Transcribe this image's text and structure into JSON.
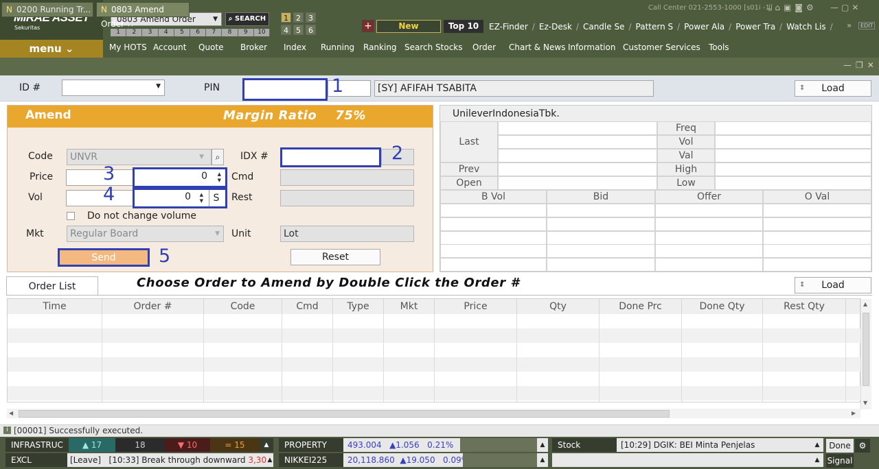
{
  "app": {
    "logo_main": "MIRAE ASSET",
    "logo_sub": "Sekuritas",
    "menu_label": "menu",
    "screen_select": "0803  Amend Order",
    "screen_numbers": [
      "1",
      "2",
      "3",
      "4",
      "5",
      "6",
      "7",
      "8",
      "9",
      "10"
    ],
    "search_label": "SEARCH",
    "window_buttons": [
      "1",
      "2",
      "3",
      "4",
      "5",
      "6"
    ],
    "call_center": "Call Center 021-2553-1000 [s01i -1]",
    "edit_label": "EDIT"
  },
  "toolbar": {
    "plus": "+",
    "new_label": "New",
    "top10_label": "Top 10",
    "quick_links": [
      "EZ-Finder",
      "Ez-Desk",
      "Candle Se",
      "Pattern S",
      "Power Ala",
      "Power Tra",
      "Watch Lis"
    ]
  },
  "nav": [
    "My HOTS",
    "Account",
    "Quote",
    "Broker",
    "Index",
    "Running",
    "Ranking",
    "Search Stocks",
    "Order",
    "Chart & News",
    "Information",
    "Customer Services",
    "Tools"
  ],
  "tabs": [
    {
      "prefix": "N",
      "label": "0200 Running Tr..."
    },
    {
      "prefix": "N",
      "label": "0803 Amend Order",
      "close": "×"
    }
  ],
  "idrow": {
    "id_label": "ID #",
    "id_value": "",
    "pin_label": "PIN",
    "pin_value": "",
    "account_name": "[SY] AFIFAH TSABITA",
    "load_label": "Load"
  },
  "amend": {
    "title": "Amend",
    "margin_label": "Margin Ratio",
    "margin_value": "75%",
    "code_label": "Code",
    "code_value": "UNVR",
    "idx_label": "IDX #",
    "idx_value": "",
    "price_label": "Price",
    "price_value": "0",
    "cmd_label": "Cmd",
    "vol_label": "Vol",
    "vol_value": "0",
    "s_label": "S",
    "rest_label": "Rest",
    "checkbox_label": "Do not change volume",
    "mkt_label": "Mkt",
    "mkt_value": "Regular Board",
    "unit_label": "Unit",
    "unit_value": "Lot",
    "send_label": "Send",
    "reset_label": "Reset"
  },
  "annotations": [
    "1",
    "2",
    "3",
    "4",
    "5"
  ],
  "quote": {
    "company": "UnileverIndonesiaTbk.",
    "last_label": "Last",
    "prev_label": "Prev",
    "open_label": "Open",
    "freq_label": "Freq",
    "vol_label": "Vol",
    "val_label": "Val",
    "high_label": "High",
    "low_label": "Low",
    "book_headers": [
      "B Vol",
      "Bid",
      "Offer",
      "O Val"
    ]
  },
  "orders": {
    "tab_label": "Order List",
    "instruction": "Choose Order to Amend by Double Click the Order #",
    "load_label": "Load",
    "columns": [
      "Time",
      "Order #",
      "Code",
      "Cmd",
      "Type",
      "Mkt",
      "Price",
      "Qty",
      "Done Prc",
      "Done Qty",
      "Rest Qty"
    ]
  },
  "status": {
    "message": "[00001] Successfully executed."
  },
  "ticker": {
    "row1": {
      "sector": "INFRASTRUC",
      "up": "▲ 17",
      "flat": "18",
      "down": "▼ 10",
      "unch": "= 15",
      "index_name": "PROPERTY",
      "index_value": "493.004",
      "index_change": "▲1.056",
      "index_pct": "0.21%",
      "news_label": "Stock",
      "news_text": "[10:29] DGIK: BEI Minta Penjelas",
      "done_label": "Done"
    },
    "row2": {
      "code": "EXCL",
      "signal_text_a": "[Leave]",
      "signal_text_b": "[10:33] Break through downward",
      "signal_value": "3,300",
      "index_name": "NIKKEI225",
      "index_value": "20,118.860",
      "index_change": "▲19.050",
      "index_pct": "0.09%",
      "signal_label": "Signal"
    }
  },
  "colors": {
    "topbar": "#4d5c3c",
    "menu_gold": "#a58522",
    "amend_header": "#e9a72d",
    "highlight_box": "#3040b0"
  }
}
